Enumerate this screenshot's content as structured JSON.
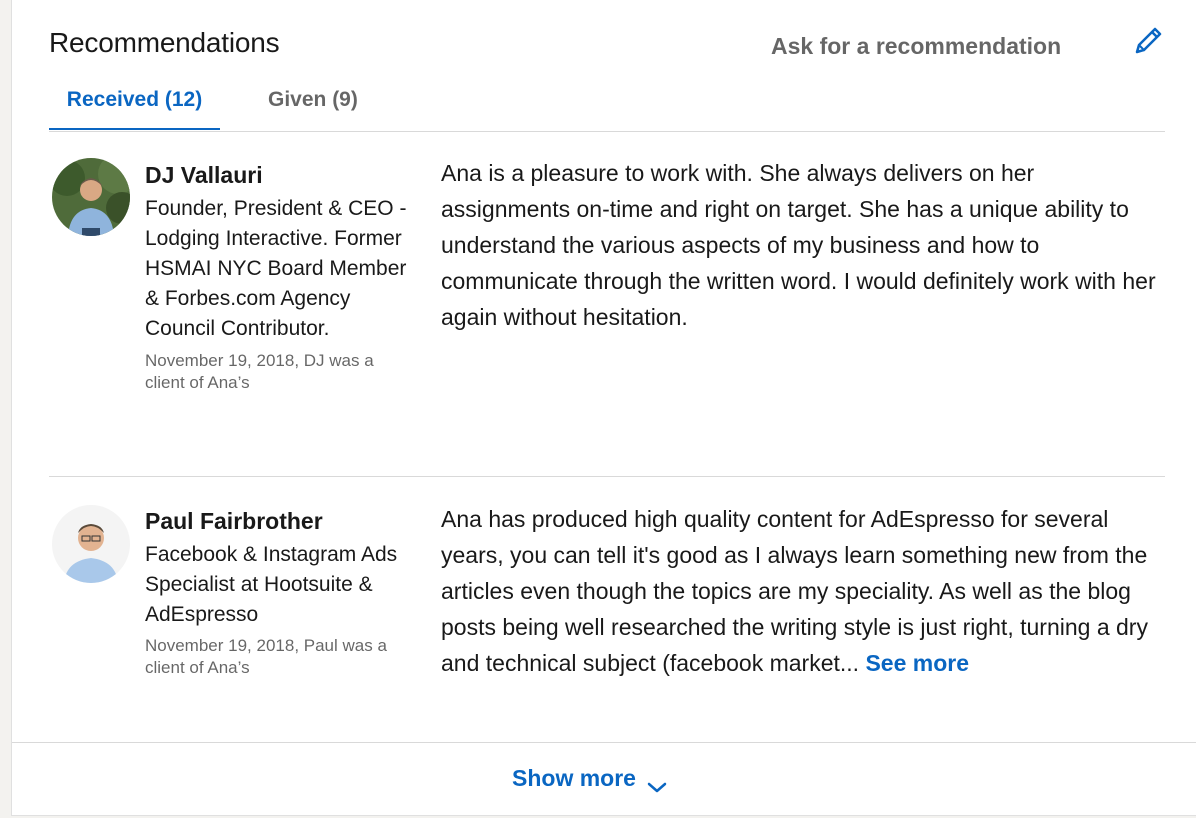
{
  "header": {
    "title": "Recommendations",
    "ask_label": "Ask for a recommendation",
    "edit_icon": "pencil-icon",
    "accent_color": "#0a66c2"
  },
  "tabs": [
    {
      "label": "Received (12)",
      "active": true
    },
    {
      "label": "Given (9)",
      "active": false
    }
  ],
  "recommendations": [
    {
      "name": "DJ Vallauri",
      "headline": "Founder, President & CEO - Lodging Interactive. Former HSMAI NYC Board Member & Forbes.com Agency Council Contributor.",
      "date": "November 19, 2018, DJ was a client of Ana’s",
      "text": "Ana is a pleasure to work with. She always delivers on her assignments on-time and right on target. She has a unique ability to understand the various aspects of my business and how to communicate through the written word. I would definitely work with her again without hesitation."
    },
    {
      "name": "Paul Fairbrother",
      "headline": "Facebook & Instagram Ads Specialist at Hootsuite & AdEspresso",
      "date": "November 19, 2018, Paul was a client of Ana’s",
      "text": "Ana has produced high quality content for AdEspresso for several years, you can tell it's good as I always learn something new from the articles even though the topics are my speciality. As well as the blog posts being well researched the writing style is just right, turning a dry and technical subject (facebook market...",
      "see_more_label": "See more"
    }
  ],
  "footer": {
    "show_more_label": "Show more",
    "chevron_icon": "chevron-down-icon"
  }
}
